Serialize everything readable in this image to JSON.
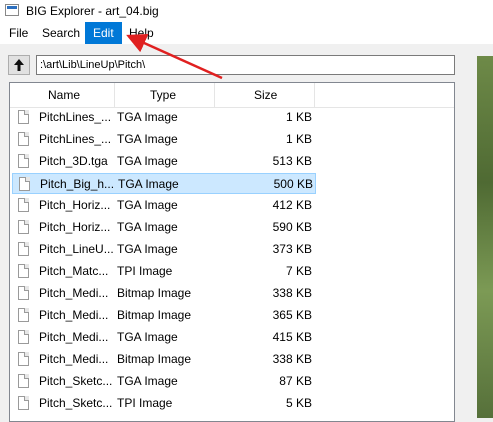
{
  "window": {
    "title": "BIG Explorer - art_04.big"
  },
  "menu": [
    {
      "label": "File",
      "active": false
    },
    {
      "label": "Search",
      "active": false
    },
    {
      "label": "Edit",
      "active": true
    },
    {
      "label": "Help",
      "active": false
    }
  ],
  "nav": {
    "path": ":\\art\\Lib\\LineUp\\Pitch\\",
    "up_icon": "arrow-up-icon"
  },
  "columns": {
    "name": "Name",
    "type": "Type",
    "size": "Size"
  },
  "files": [
    {
      "name": "PitchLines_...",
      "type": "TGA Image",
      "size": "1 KB"
    },
    {
      "name": "PitchLines_...",
      "type": "TGA Image",
      "size": "1 KB"
    },
    {
      "name": "Pitch_3D.tga",
      "type": "TGA Image",
      "size": "513 KB"
    },
    {
      "name": "Pitch_Big_h...",
      "type": "TGA Image",
      "size": "500 KB",
      "selected": true
    },
    {
      "name": "Pitch_Horiz...",
      "type": "TGA Image",
      "size": "412 KB"
    },
    {
      "name": "Pitch_Horiz...",
      "type": "TGA Image",
      "size": "590 KB"
    },
    {
      "name": "Pitch_LineU...",
      "type": "TGA Image",
      "size": "373 KB"
    },
    {
      "name": "Pitch_Matc...",
      "type": "TPI Image",
      "size": "7 KB"
    },
    {
      "name": "Pitch_Medi...",
      "type": "Bitmap Image",
      "size": "338 KB"
    },
    {
      "name": "Pitch_Medi...",
      "type": "Bitmap Image",
      "size": "365 KB"
    },
    {
      "name": "Pitch_Medi...",
      "type": "TGA Image",
      "size": "415 KB"
    },
    {
      "name": "Pitch_Medi...",
      "type": "Bitmap Image",
      "size": "338 KB"
    },
    {
      "name": "Pitch_Sketc...",
      "type": "TGA Image",
      "size": "87 KB"
    },
    {
      "name": "Pitch_Sketc...",
      "type": "TPI Image",
      "size": "5 KB"
    }
  ],
  "colors": {
    "selection": "#cce8ff",
    "menu_active": "#0078d7",
    "annotation": "#e02020"
  }
}
